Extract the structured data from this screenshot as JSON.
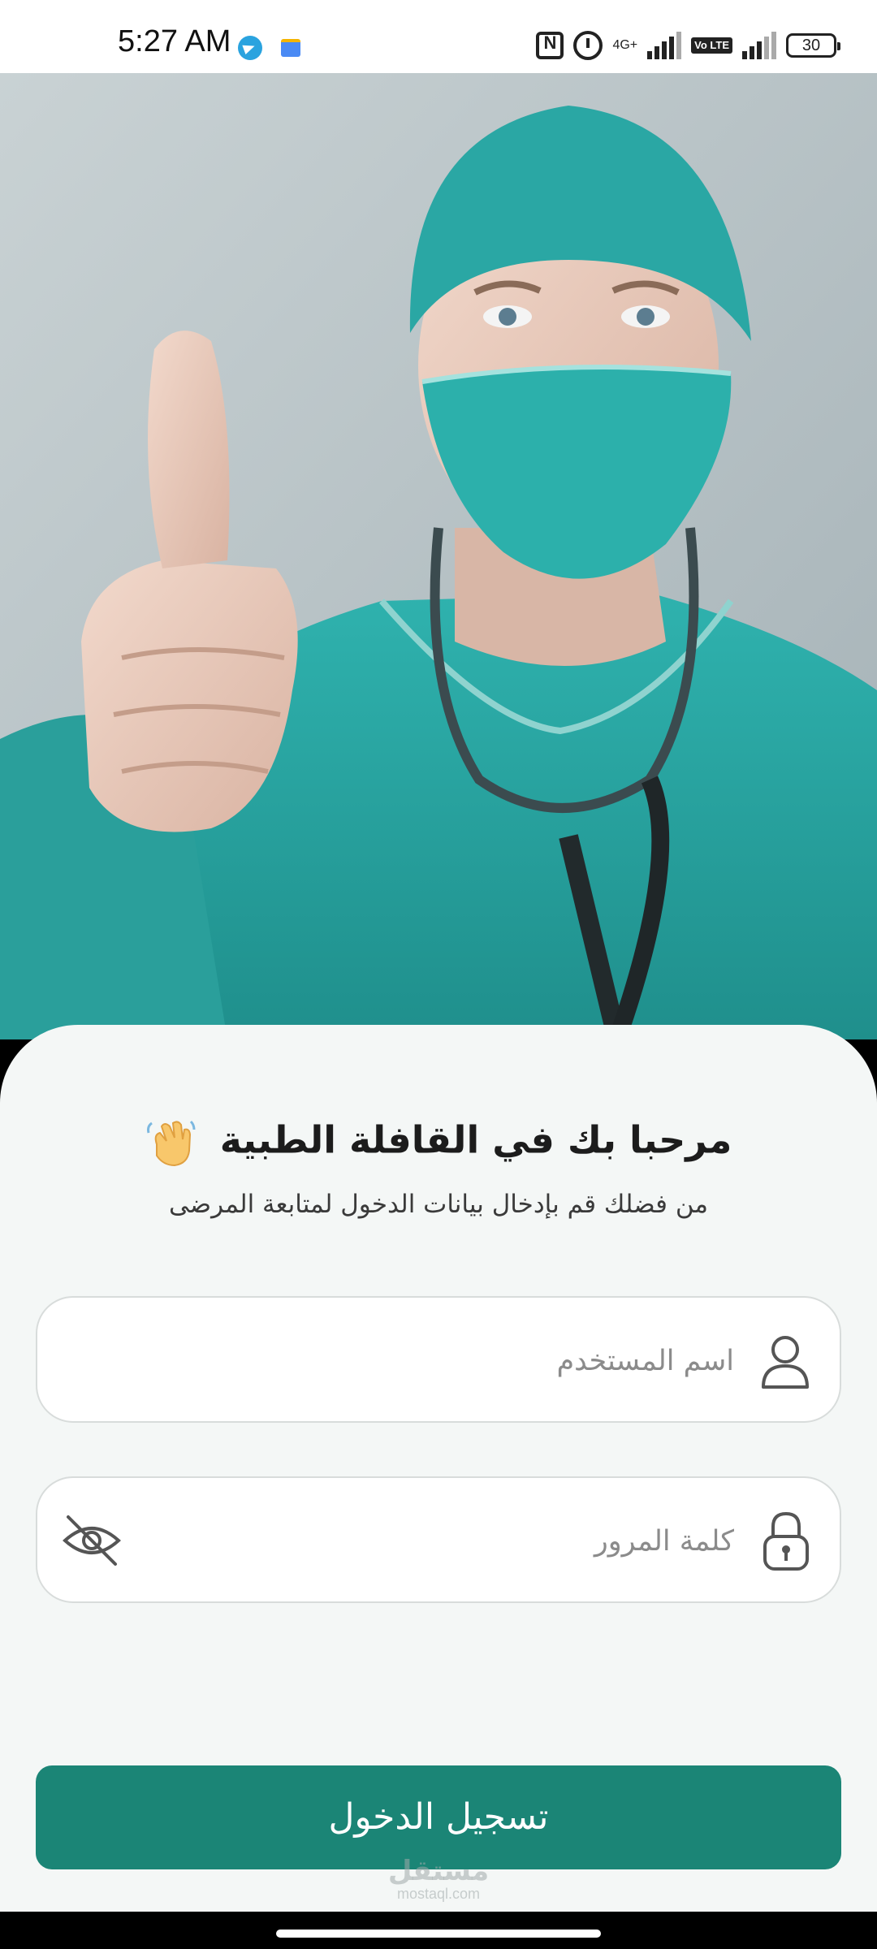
{
  "status_bar": {
    "time": "5:27 AM",
    "network_label": "4G+",
    "volte_label": "Vo LTE",
    "battery": "30",
    "icons": [
      "telegram-icon",
      "google-news-icon",
      "nfc-icon",
      "alarm-icon",
      "signal-icon",
      "battery-icon"
    ]
  },
  "hero": {
    "image_description_icon": "doctor-photo"
  },
  "login": {
    "welcome_title": "مرحبا بك في القافلة الطبية",
    "welcome_emoji": "wave-hand-icon",
    "subtitle": "من فضلك قم بإدخال بيانات الدخول لمتابعة المرضى",
    "username": {
      "placeholder": "اسم المستخدم",
      "value": "",
      "icon": "person-icon"
    },
    "password": {
      "placeholder": "كلمة المرور",
      "value": "",
      "icon": "lock-icon",
      "toggle_icon": "eye-off-icon"
    },
    "submit_label": "تسجيل الدخول"
  },
  "watermark": {
    "text": "مستقل",
    "sub": "mostaql.com"
  },
  "colors": {
    "primary": "#1b8576",
    "card_background": "#f4f7f6",
    "scrubs": "#2aa7a4"
  }
}
